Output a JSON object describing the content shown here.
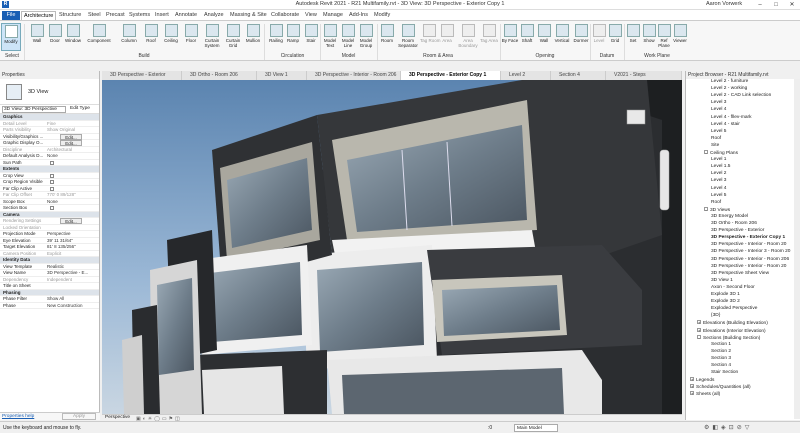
{
  "titlebar": {
    "title": "Autodesk Revit 2021 - R21 Multifamily.rvt - 3D View: 3D Perspective - Exterior Copy 1",
    "user": "Aaron Vorwerk"
  },
  "tabs": [
    "File",
    "Architecture",
    "Structure",
    "Steel",
    "Precast",
    "Systems",
    "Insert",
    "Annotate",
    "Analyze",
    "Massing & Site",
    "Collaborate",
    "View",
    "Manage",
    "Add-Ins",
    "Modify"
  ],
  "ribbon": {
    "modify": "Modify",
    "select": "Select",
    "build": [
      "Wall",
      "Door",
      "Window",
      "Component",
      "Column",
      "Roof",
      "Ceiling",
      "Floor",
      "Curtain System",
      "Curtain Grid",
      "Mullion"
    ],
    "build_label": "Build",
    "circulation": [
      "Railing",
      "Ramp",
      "Stair"
    ],
    "circulation_label": "Circulation",
    "model": [
      "Model Text",
      "Model Line",
      "Model Group"
    ],
    "model_label": "Model",
    "room": [
      "Room",
      "Room Separator",
      "Tag Room",
      "Area",
      "Area Boundary",
      "Tag Area"
    ],
    "room_label": "Room & Area",
    "opening": [
      "By Face",
      "Shaft",
      "Wall",
      "Vertical",
      "Dormer"
    ],
    "opening_label": "Opening",
    "datum": [
      "Level",
      "Grid"
    ],
    "datum_label": "Datum",
    "workplane": [
      "Set",
      "Show",
      "Ref Plane",
      "Viewer"
    ],
    "workplane_label": "Work Plane"
  },
  "viewtabs": [
    "3D Perspective - Exterior",
    "3D Ortho - Room 206",
    "3D View 1",
    "3D Perspective - Interior - Room 206",
    "3D Perspective - Exterior Copy 1",
    "Level 2",
    "Section 4",
    "V2021 - Steps"
  ],
  "properties": {
    "title": "Properties",
    "type": "3D View",
    "selector": "3D View: 3D Perspective",
    "edit_type": "Edit Type",
    "rows": [
      {
        "k": "Graphics",
        "sec": true
      },
      {
        "k": "Detail Level",
        "v": "Fine",
        "gray": true
      },
      {
        "k": "Parts Visibility",
        "v": "Show Original",
        "gray": true
      },
      {
        "k": "Visibility/Graphics ...",
        "v": "Edit..."
      },
      {
        "k": "Graphic Display O...",
        "v": "Edit..."
      },
      {
        "k": "Discipline",
        "v": "Architectural",
        "gray": true
      },
      {
        "k": "Default Analysis D...",
        "v": "None"
      },
      {
        "k": "Sun Path",
        "chk": true
      },
      {
        "k": "Extents",
        "sec": true
      },
      {
        "k": "Crop View",
        "chk": true
      },
      {
        "k": "Crop Region Visible",
        "chk": true
      },
      {
        "k": "Far Clip Active",
        "chk": true
      },
      {
        "k": "Far Clip Offset",
        "v": "770' 0 89/128\"",
        "gray": true
      },
      {
        "k": "Scope Box",
        "v": "None"
      },
      {
        "k": "Section Box",
        "chk": true
      },
      {
        "k": "Camera",
        "sec": true
      },
      {
        "k": "Rendering Settings",
        "v": "Edit...",
        "gray": true
      },
      {
        "k": "Locked Orientation",
        "gray": true
      },
      {
        "k": "Projection Mode",
        "v": "Perspective"
      },
      {
        "k": "Eye Elevation",
        "v": "39' 11 31/64\""
      },
      {
        "k": "Target Elevation",
        "v": "81' 8 135/256\""
      },
      {
        "k": "Camera Position",
        "v": "Explicit",
        "gray": true
      },
      {
        "k": "Identity Data",
        "sec": true
      },
      {
        "k": "View Template",
        "v": "Realistic"
      },
      {
        "k": "View Name",
        "v": "3D Perspective - E..."
      },
      {
        "k": "Dependency",
        "v": "Independent",
        "gray": true
      },
      {
        "k": "Title on Sheet"
      },
      {
        "k": "Phasing",
        "sec": true
      },
      {
        "k": "Phase Filter",
        "v": "Show All"
      },
      {
        "k": "Phase",
        "v": "New Construction"
      }
    ],
    "help": "Properties help",
    "apply": "Apply"
  },
  "browser": {
    "title": "Project Browser - R21 Multifamily.rvt",
    "items": [
      {
        "t": "Level 2 - furniture",
        "i": 3
      },
      {
        "t": "Level 2 - working",
        "i": 3
      },
      {
        "t": "Level 2 - CAD Link selection",
        "i": 3
      },
      {
        "t": "Level 3",
        "i": 3
      },
      {
        "t": "Level 4",
        "i": 3
      },
      {
        "t": "Level 4 - fllev-mark",
        "i": 3
      },
      {
        "t": "Level 4 - stair",
        "i": 3
      },
      {
        "t": "Level 5",
        "i": 3
      },
      {
        "t": "Roof",
        "i": 3
      },
      {
        "t": "Site",
        "i": 3
      },
      {
        "t": "Ceiling Plans",
        "i": 2,
        "tog": "-"
      },
      {
        "t": "Level 1",
        "i": 3
      },
      {
        "t": "Level 1.5",
        "i": 3
      },
      {
        "t": "Level 2",
        "i": 3
      },
      {
        "t": "Level 3",
        "i": 3
      },
      {
        "t": "Level 4",
        "i": 3
      },
      {
        "t": "Level 5",
        "i": 3
      },
      {
        "t": "Roof",
        "i": 3
      },
      {
        "t": "3D Views",
        "i": 2,
        "tog": "-"
      },
      {
        "t": "3D Energy Model",
        "i": 3
      },
      {
        "t": "3D Ortho - Room 206",
        "i": 3
      },
      {
        "t": "3D Perspective - Exterior",
        "i": 3
      },
      {
        "t": "3D Perspective - Exterior Copy 1",
        "i": 3,
        "b": true
      },
      {
        "t": "3D Perspective - Interior - Room 20",
        "i": 3
      },
      {
        "t": "3D Perspective - Interior 3 - Room 20",
        "i": 3
      },
      {
        "t": "3D Perspective - Interior - Room 206",
        "i": 3
      },
      {
        "t": "3D Perspective - Interior - Room 20",
        "i": 3
      },
      {
        "t": "3D Perspective Sheet View",
        "i": 3
      },
      {
        "t": "3D View 1",
        "i": 3
      },
      {
        "t": "Axon - Second Floor",
        "i": 3
      },
      {
        "t": "Explode 3D 1",
        "i": 3
      },
      {
        "t": "Explode 3D 2",
        "i": 3
      },
      {
        "t": "Exploded Perspective",
        "i": 3
      },
      {
        "t": "{3D}",
        "i": 3
      },
      {
        "t": "Elevations (Building Elevation)",
        "i": 1,
        "tog": "+"
      },
      {
        "t": "Elevations (Interior Elevation)",
        "i": 1,
        "tog": "+"
      },
      {
        "t": "Sections (Building Section)",
        "i": 1,
        "tog": "-"
      },
      {
        "t": "Section 1",
        "i": 3
      },
      {
        "t": "Section 2",
        "i": 3
      },
      {
        "t": "Section 3",
        "i": 3
      },
      {
        "t": "Section 4",
        "i": 3
      },
      {
        "t": "Stair Section",
        "i": 3
      },
      {
        "t": "Legends",
        "i": 0,
        "tog": "+"
      },
      {
        "t": "Schedules/Quantities (all)",
        "i": 0,
        "tog": "+"
      },
      {
        "t": "Sheets (all)",
        "i": 0,
        "tog": "+"
      }
    ]
  },
  "viewbar": {
    "mode": "Perspective"
  },
  "status": {
    "hint": "Use the keyboard and mouse to fly.",
    "zero": ":0",
    "model": "Main Model"
  }
}
